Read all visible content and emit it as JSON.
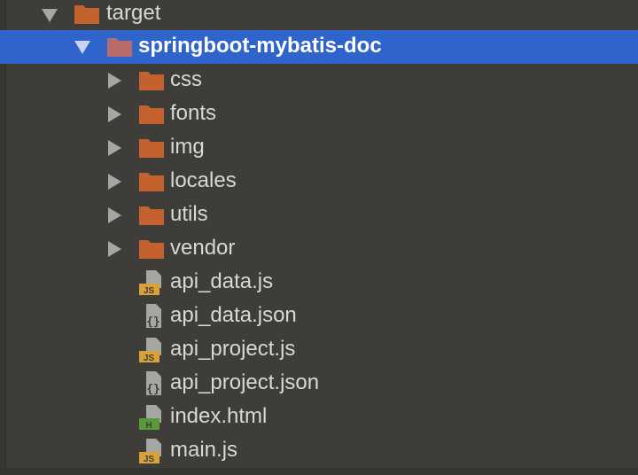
{
  "tree": {
    "target": {
      "label": "target",
      "icon": "folder-icon",
      "expanded": true
    },
    "project": {
      "label": "springboot-mybatis-doc",
      "icon": "folder-icon",
      "expanded": true,
      "selected": true
    },
    "folders": [
      {
        "label": "css",
        "icon": "folder-icon"
      },
      {
        "label": "fonts",
        "icon": "folder-icon"
      },
      {
        "label": "img",
        "icon": "folder-icon"
      },
      {
        "label": "locales",
        "icon": "folder-icon"
      },
      {
        "label": "utils",
        "icon": "folder-icon"
      },
      {
        "label": "vendor",
        "icon": "folder-icon"
      }
    ],
    "files": [
      {
        "label": "api_data.js",
        "icon": "js-file-icon",
        "badge": "JS"
      },
      {
        "label": "api_data.json",
        "icon": "json-file-icon",
        "badge": "{}"
      },
      {
        "label": "api_project.js",
        "icon": "js-file-icon",
        "badge": "JS"
      },
      {
        "label": "api_project.json",
        "icon": "json-file-icon",
        "badge": "{}"
      },
      {
        "label": "index.html",
        "icon": "html-file-icon",
        "badge": "H"
      },
      {
        "label": "main.js",
        "icon": "js-file-icon",
        "badge": "JS"
      }
    ]
  },
  "colors": {
    "background": "#3e3d3a",
    "selection": "#2f65ca",
    "folder": "#c4622f",
    "selected_folder": "#b86b6b",
    "js_badge": "#d8a13a",
    "html_badge": "#5a9a3a",
    "file_gray": "#a6a6a2"
  }
}
